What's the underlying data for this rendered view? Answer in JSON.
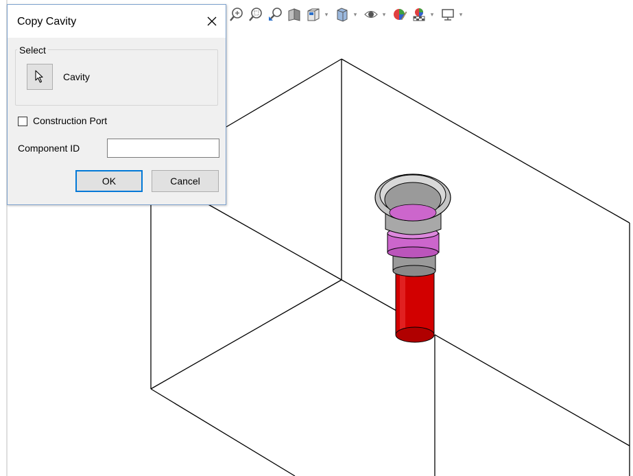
{
  "dialog": {
    "title": "Copy Cavity",
    "select_group_label": "Select",
    "pick_target_label": "Cavity",
    "construction_port_label": "Construction Port",
    "construction_port_checked": false,
    "component_id_label": "Component ID",
    "component_id_value": "",
    "ok_label": "OK",
    "cancel_label": "Cancel"
  },
  "toolbar": {
    "buttons": [
      {
        "icon": "zoom-to-fit-icon"
      },
      {
        "icon": "zoom-window-icon"
      },
      {
        "icon": "zoom-previous-icon"
      },
      {
        "icon": "section-view-icon"
      },
      {
        "icon": "view-orientation-icon",
        "dropdown": true
      },
      {
        "icon": "display-style-icon",
        "dropdown": true
      },
      {
        "icon": "hide-show-icon",
        "dropdown": true
      },
      {
        "icon": "edit-appearance-icon"
      },
      {
        "icon": "apply-scene-icon",
        "dropdown": true
      },
      {
        "icon": "view-settings-icon",
        "dropdown": true
      }
    ]
  },
  "colors": {
    "cavity_red": "#d20000",
    "cavity_gray": "#a0a0a0",
    "cavity_magenta": "#cc66cc",
    "dialog_border": "#7da2ce",
    "ok_border": "#0078d7"
  }
}
